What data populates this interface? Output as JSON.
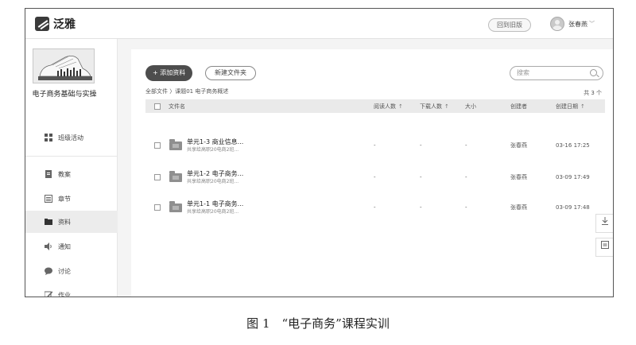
{
  "app": {
    "logo_text": "泛雅"
  },
  "header": {
    "back_button": "回到旧版",
    "user_name": "张春燕",
    "chevron": "﹀"
  },
  "sidebar": {
    "course_title": "电子商务基础与实操",
    "items": [
      {
        "label": "班级活动",
        "icon": "grid-icon"
      },
      {
        "label": "教案",
        "icon": "doc-icon"
      },
      {
        "label": "章节",
        "icon": "list-icon"
      },
      {
        "label": "资料",
        "icon": "folder-icon",
        "active": true
      },
      {
        "label": "通知",
        "icon": "speaker-icon"
      },
      {
        "label": "讨论",
        "icon": "chat-icon"
      },
      {
        "label": "作业",
        "icon": "edit-icon"
      }
    ]
  },
  "toolbar": {
    "add_button": "+ 添加资料",
    "new_folder_button": "新建文件夹",
    "search_placeholder": "搜索"
  },
  "breadcrumb": "全部文件 〉课题01 电子商务概述",
  "count": "共 3 个",
  "table": {
    "headers": {
      "name": "文件名",
      "views": "阅读人数",
      "downloads": "下载人数",
      "size": "大小",
      "creator": "创建者",
      "date": "创建日期"
    },
    "sort_icon": "↑",
    "rows": [
      {
        "name": "单元1-3 商业信息...",
        "sub": "共享给高职20电商2班...",
        "views": "-",
        "downloads": "-",
        "size": "-",
        "creator": "张春燕",
        "date": "03-16 17:25"
      },
      {
        "name": "单元1-2 电子商务...",
        "sub": "共享给高职20电商2班...",
        "views": "-",
        "downloads": "-",
        "size": "-",
        "creator": "张春燕",
        "date": "03-09 17:49"
      },
      {
        "name": "单元1-1 电子商务...",
        "sub": "共享给高职20电商2班...",
        "views": "-",
        "downloads": "-",
        "size": "-",
        "creator": "张春燕",
        "date": "03-09 17:48"
      }
    ]
  },
  "caption": "图 1　“电子商务”课程实训"
}
